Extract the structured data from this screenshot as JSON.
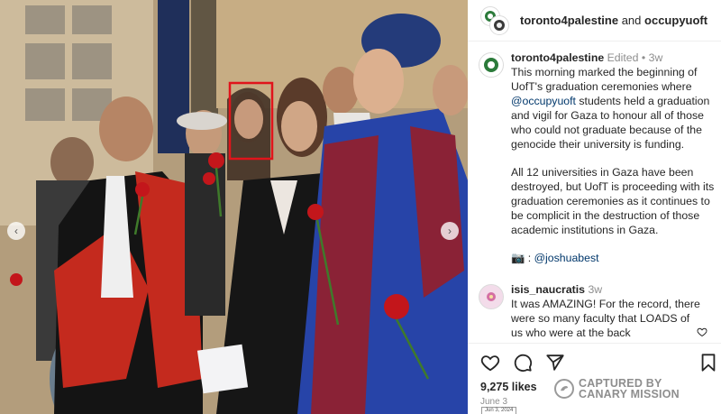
{
  "post": {
    "header": {
      "author": "toronto4palestine",
      "joiner": "and",
      "collaborator": "occupyuoft"
    },
    "caption": {
      "author": "toronto4palestine",
      "edited": "Edited",
      "dot": "•",
      "age": "3w",
      "p1_a": "This morning marked the beginning of UofT's graduation ceremonies where",
      "p1_mention": "@occupyuoft",
      "p1_b": "students held a graduation and vigil for Gaza to honour all of those who could not graduate because of the genocide their university is funding.",
      "p2": "All 12 universities in Gaza have been destroyed, but UofT is proceeding with its graduation ceremonies as it continues to be complicit in the destruction of those academic institutions in Gaza.",
      "credit_icon": "camera-emoji",
      "credit_prefix": "📷 :",
      "credit_handle": "@joshuabest"
    },
    "comment": {
      "author": "isis_naucratis",
      "age": "3w",
      "text": "It was AMAZING! For the record, there were so many faculty that LOADS of us who were at the back"
    },
    "likes": "9,275 likes",
    "date": "June 3",
    "stamp": "Jun 3, 2024"
  },
  "watermark": {
    "line1": "CAPTURED BY",
    "line2": "CANARY MISSION"
  },
  "carousel": {
    "prev": "‹",
    "next": "›"
  },
  "icons": {
    "like": "heart-icon",
    "comment": "comment-icon",
    "share": "share-icon",
    "save": "bookmark-icon",
    "comment_like": "heart-icon"
  },
  "colors": {
    "link": "#00376b",
    "muted": "#8e8e8e",
    "highlight_box": "#e0141b"
  }
}
